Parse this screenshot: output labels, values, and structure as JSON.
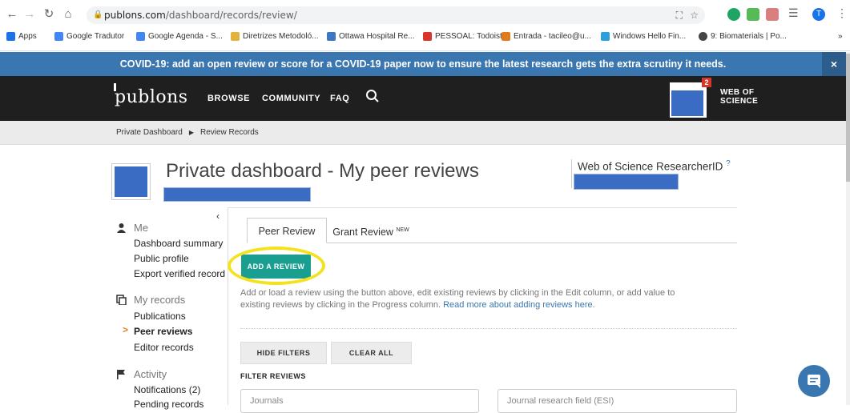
{
  "browser": {
    "url_host": "publons.com",
    "url_path": "/dashboard/records/review/",
    "bookmarks": [
      {
        "label": "Apps",
        "color": "#1a73e8"
      },
      {
        "label": "Google Tradutor",
        "color": "#4285f4"
      },
      {
        "label": "Google Agenda - S...",
        "color": "#4285f4"
      },
      {
        "label": "Diretrizes Metodoló...",
        "color": "#e3b23c"
      },
      {
        "label": "Ottawa Hospital Re...",
        "color": "#3b78c4"
      },
      {
        "label": "PESSOAL: Todoist",
        "color": "#d9362a"
      },
      {
        "label": "Entrada - tacileo@u...",
        "color": "#e27b1e"
      },
      {
        "label": "Windows Hello Fin...",
        "color": "#2ba0dd"
      },
      {
        "label": "9: Biomaterials | Po...",
        "color": "#444444"
      }
    ],
    "profile_initial": "T"
  },
  "banner": {
    "text": "COVID-19: add an open review or score for a COVID-19 paper now to ensure the latest research gets the extra scrutiny it needs.",
    "close": "×"
  },
  "nav": {
    "logo": "publons",
    "links": [
      "BROWSE",
      "COMMUNITY",
      "FAQ"
    ],
    "notif_count": "2",
    "wos_line1": "WEB OF",
    "wos_line2": "SCIENCE"
  },
  "breadcrumb": {
    "item1": "Private Dashboard",
    "item2": "Review Records"
  },
  "page": {
    "title": "Private dashboard - My peer reviews",
    "researcher_id_label": "Web of Science ResearcherID",
    "researcher_id_help": "?"
  },
  "sidebar": {
    "collapse": "‹",
    "me_label": "Me",
    "me_items": [
      "Dashboard summary",
      "Public profile",
      "Export verified record"
    ],
    "records_label": "My records",
    "records_items": [
      "Publications",
      "Peer reviews",
      "Editor records"
    ],
    "activity_label": "Activity",
    "activity_items": [
      "Notifications (2)",
      "Pending records"
    ]
  },
  "tabs": {
    "peer_review": "Peer Review",
    "grant_review": "Grant Review",
    "new_tag": "NEW"
  },
  "actions": {
    "add_review": "ADD A REVIEW",
    "help_text": "Add or load a review using the button above, edit existing reviews by clicking in the Edit column, or add value to existing reviews by clicking in the Progress column. ",
    "help_link": "Read more about adding reviews here",
    "help_end": ".",
    "hide_filters": "HIDE FILTERS",
    "clear_all": "CLEAR ALL",
    "filter_reviews": "FILTER REVIEWS",
    "journals_placeholder": "Journals",
    "field_placeholder": "Journal research field (ESI)"
  },
  "colors": {
    "banner": "#3a77b0",
    "nav": "#1f1f1f",
    "add_button": "#1a9e8f",
    "highlight": "#f4e21e",
    "redaction": "#3b6cc4"
  }
}
